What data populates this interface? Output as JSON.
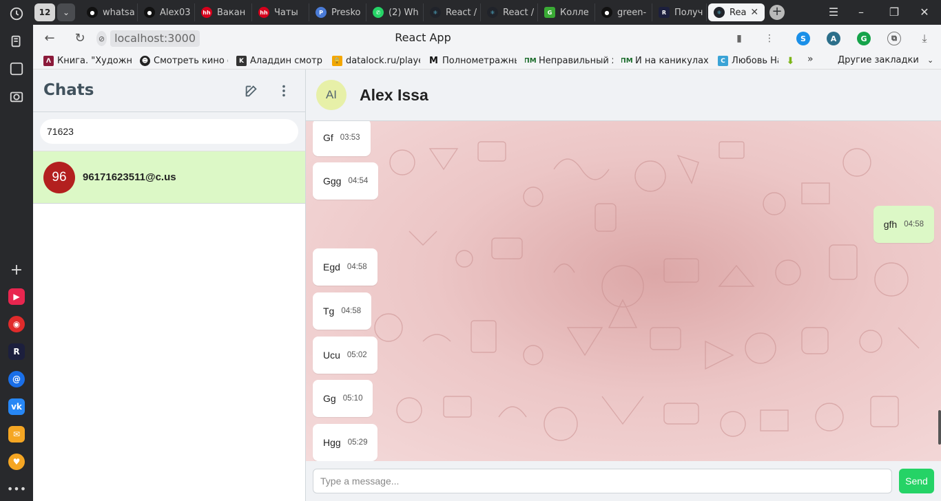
{
  "browser": {
    "tab_count": "12",
    "tabs": [
      {
        "label": "whatsa",
        "icon": "github-icon"
      },
      {
        "label": "Alex03",
        "icon": "github-icon"
      },
      {
        "label": "Вакан",
        "icon": "hh-icon"
      },
      {
        "label": "Чаты",
        "icon": "hh-icon"
      },
      {
        "label": "Presko",
        "icon": "presko-icon"
      },
      {
        "label": "(2) Wh",
        "icon": "whatsapp-icon"
      },
      {
        "label": "React /",
        "icon": "react-icon"
      },
      {
        "label": "React /",
        "icon": "react-icon"
      },
      {
        "label": "Колле",
        "icon": "green-g-icon"
      },
      {
        "label": "green-",
        "icon": "github-icon"
      },
      {
        "label": "Получ",
        "icon": "r-icon"
      },
      {
        "label": "Rea",
        "icon": "react-icon",
        "active": true
      }
    ],
    "url": "localhost:3000",
    "page_title": "React App",
    "bookmarks": [
      {
        "label": "Книга. \"Художниц",
        "icon": "book-icon",
        "color": "#8b1a3a"
      },
      {
        "label": "Смотреть кино ф",
        "icon": "mask-icon",
        "color": "#222222"
      },
      {
        "label": "Аладдин смотрет",
        "icon": "k-icon",
        "color": "#333333"
      },
      {
        "label": "datalock.ru/player",
        "icon": "lock-icon",
        "color": "#f4a700"
      },
      {
        "label": "Полнометражные",
        "icon": "m-icon",
        "color": "#111111"
      },
      {
        "label": "Неправильный хр",
        "icon": "pm-icon",
        "color": "#1a6b2a"
      },
      {
        "label": "И на каникулах не",
        "icon": "pm-icon",
        "color": "#1a6b2a"
      },
      {
        "label": "Любовь На",
        "icon": "c-icon",
        "color": "#3aa3d6"
      }
    ],
    "bookmarks_more": "»",
    "other_bookmarks": "Другие закладки"
  },
  "sidebar": {
    "title": "Chats",
    "search_value": "71623",
    "chats": [
      {
        "avatar_text": "96",
        "name": "96171623511@c.us",
        "avatar_color": "#b3201f"
      }
    ]
  },
  "chat": {
    "avatar_text": "AI",
    "title": "Alex Issa",
    "messages": [
      {
        "text": "Gf",
        "time": "03:53",
        "direction": "in"
      },
      {
        "text": "Ggg",
        "time": "04:54",
        "direction": "in"
      },
      {
        "text": "gfh",
        "time": "04:58",
        "direction": "out"
      },
      {
        "text": "Egd",
        "time": "04:58",
        "direction": "in"
      },
      {
        "text": "Tg",
        "time": "04:58",
        "direction": "in"
      },
      {
        "text": "Ucu",
        "time": "05:02",
        "direction": "in"
      },
      {
        "text": "Gg",
        "time": "05:10",
        "direction": "in"
      },
      {
        "text": "Hgg",
        "time": "05:29",
        "direction": "in"
      }
    ],
    "input_placeholder": "Type a message...",
    "send_label": "Send"
  },
  "colors": {
    "outgoing_bubble": "#dcf8c6",
    "send_button": "#25d366",
    "chat_bg": "#ecc6c6"
  }
}
